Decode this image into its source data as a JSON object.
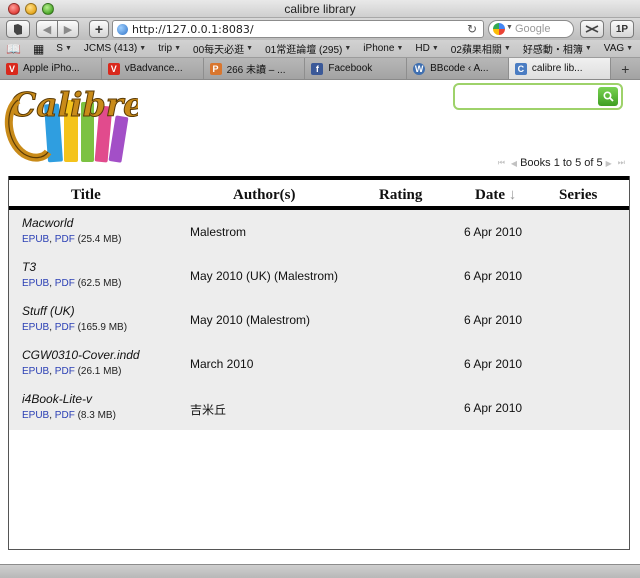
{
  "window": {
    "title": "calibre library"
  },
  "toolbar": {
    "url": "http://127.0.0.1:8083/",
    "search_placeholder": "Google",
    "right_button_label": "1P"
  },
  "bookmarks": [
    {
      "label": "S",
      "menu": true
    },
    {
      "label": "JCMS (413)",
      "menu": true
    },
    {
      "label": "trip",
      "menu": true
    },
    {
      "label": "00每天必逛",
      "menu": true
    },
    {
      "label": "01常逛論壇 (295)",
      "menu": true
    },
    {
      "label": "iPhone",
      "menu": true
    },
    {
      "label": "HD",
      "menu": true
    },
    {
      "label": "02蘋果相關",
      "menu": true
    },
    {
      "label": "好感動・相簿",
      "menu": true
    },
    {
      "label": "VAG",
      "menu": true
    }
  ],
  "tabs": [
    {
      "label": "Apple iPho...",
      "icon": "vbulletin-icon",
      "color": "#d9281c",
      "glyph": "V"
    },
    {
      "label": "vBadvance...",
      "icon": "vbulletin-icon",
      "color": "#d9281c",
      "glyph": "V"
    },
    {
      "label": "266 未讀 – ...",
      "icon": "plurk-icon",
      "color": "#d9762e",
      "glyph": "P"
    },
    {
      "label": "Facebook",
      "icon": "facebook-icon",
      "color": "#3b5998",
      "glyph": "f"
    },
    {
      "label": "BBcode ‹ A...",
      "icon": "wordpress-icon",
      "color": "#3f6fb0",
      "glyph": "W"
    },
    {
      "label": "calibre lib...",
      "icon": "calibre-icon",
      "color": "#4a7cc2",
      "glyph": "C"
    }
  ],
  "page": {
    "logo_text": "Calibre",
    "pager": {
      "label": "Books 1 to 5 of 5"
    },
    "table": {
      "headers": {
        "title": "Title",
        "authors": "Author(s)",
        "rating": "Rating",
        "date": "Date",
        "date_sort_indicator": "↓",
        "series": "Series"
      },
      "rows": [
        {
          "title": "Macworld",
          "formats": [
            "EPUB",
            "PDF"
          ],
          "size": "(25.4 MB)",
          "author": "Malestrom",
          "date": "6 Apr 2010"
        },
        {
          "title": "T3",
          "formats": [
            "EPUB",
            "PDF"
          ],
          "size": "(62.5 MB)",
          "author": "May 2010 (UK) (Malestrom)",
          "date": "6 Apr 2010"
        },
        {
          "title": "Stuff (UK)",
          "formats": [
            "EPUB",
            "PDF"
          ],
          "size": "(165.9 MB)",
          "author": "May 2010 (Malestrom)",
          "date": "6 Apr 2010"
        },
        {
          "title": "CGW0310-Cover.indd",
          "formats": [
            "EPUB",
            "PDF"
          ],
          "size": "(26.1 MB)",
          "author": "March 2010",
          "date": "6 Apr 2010"
        },
        {
          "title": "i4Book-Lite-v",
          "formats": [
            "EPUB",
            "PDF"
          ],
          "size": "(8.3 MB)",
          "author": "吉米丘",
          "date": "6 Apr 2010"
        }
      ]
    }
  },
  "colors": {
    "link": "#2a3fb5",
    "search_accent": "#9ed26a",
    "row_background": "#ededed"
  }
}
